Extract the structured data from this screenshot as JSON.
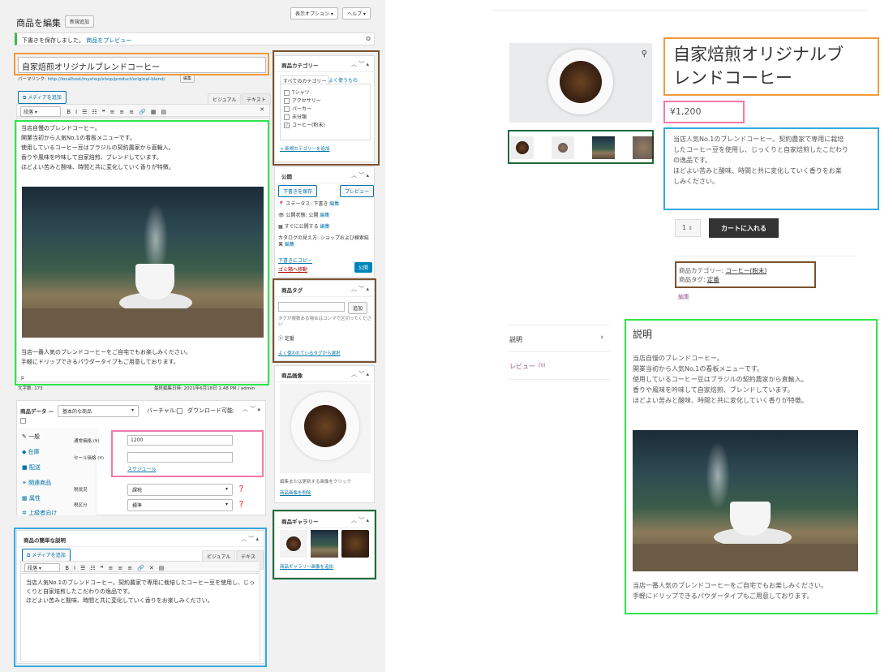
{
  "admin": {
    "page_title": "商品を編集",
    "add_new": "新規追加",
    "screen_options": "表示オプション ▾",
    "help": "ヘルプ ▾",
    "notice": "下書きを保存しました。",
    "notice_link": "商品をプレビュー",
    "product_title": "自家焙煎オリジナルブレンドコーヒー",
    "permalink_label": "パーマリンク:",
    "permalink_url": "http://localhost/myshop/shop/product/original-blend/",
    "permalink_edit": "編集",
    "add_media": "メディアを追加",
    "tab_visual": "ビジュアル",
    "tab_text": "テキスト",
    "format_select": "段落",
    "toolbar_icons": [
      "B",
      "I",
      "☰",
      "☷",
      "❝",
      "≡",
      "≡",
      "≡",
      "🔗",
      "▦",
      "▤"
    ],
    "content_lines": [
      "当店自慢のブレンドコーヒー。",
      "開業当初から人気No.1の看板メニューです。",
      "",
      "使用しているコーヒー豆はブラジルの契約農家から直輸入。",
      "香りや風味を吟味して自家焙煎、ブレンドしています。",
      "ほどよい苦みと酸味、時間と共に変化していく香りが特徴。"
    ],
    "content_lines2": [
      "当店一番人気のブレンドコーヒーをご自宅でもお楽しみください。",
      "手軽にドリップできるパウダータイプもご用意しております。"
    ],
    "content_p": "p",
    "word_count": "文字数: 173",
    "last_edited": "最終編集日時: 2021年6月18日 1:48 PM / admin",
    "product_data_label": "商品データ —",
    "product_type": "基本的な商品",
    "virtual_label": "バーチャル:",
    "download_label": "ダウンロード可能:",
    "data_tabs": [
      "一般",
      "在庫",
      "配送",
      "関連商品",
      "属性",
      "上級者向け"
    ],
    "regular_price_label": "通常価格 (¥)",
    "regular_price": "1200",
    "sale_price_label": "セール価格 (¥)",
    "sale_price": "",
    "schedule": "スケジュール",
    "tax_status_label": "税状況",
    "tax_status": "課税",
    "tax_class_label": "税区分",
    "tax_class": "標準",
    "short_desc_title": "商品の簡単な説明",
    "short_desc_lines": [
      "当店人気No.1のブレンドコーヒー。契約農家で専用に栽培したコーヒー豆を使用し、じっ",
      "くりと自家焙煎したこだわりの逸品です。",
      "",
      "ほどよい苦みと酸味、時間と共に変化していく香りをお楽しみください。"
    ],
    "categories_title": "商品カテゴリー",
    "cat_tab_all": "すべてのカテゴリー",
    "cat_tab_popular": "よく使うもの",
    "categories": [
      {
        "label": "Tシャツ",
        "checked": false
      },
      {
        "label": "アクセサリー",
        "checked": false
      },
      {
        "label": "パーカー",
        "checked": false
      },
      {
        "label": "未分類",
        "checked": false
      },
      {
        "label": "コーヒー(粉末)",
        "checked": true
      }
    ],
    "add_category": "+ 新規カテゴリーを追加",
    "publish_title": "公開",
    "save_draft": "下書きを保存",
    "preview": "プレビュー",
    "status_line": "ステータス: 下書き",
    "status_edit": "編集",
    "visibility_line": "公開状態: 公開",
    "visibility_edit": "編集",
    "schedule_line": "すぐに公開する",
    "schedule_edit": "編集",
    "catalog_line": "カタログの見え方: ショップおよび検索結果",
    "catalog_edit": "編集",
    "copy_draft": "下書きにコピー",
    "trash": "ゴミ箱へ移動",
    "publish_btn": "公開",
    "tags_title": "商品タグ",
    "tag_add_btn": "追加",
    "tag_hint": "タグが複数ある場合はコンマで区切ってください",
    "tag_item": "ⓧ 定番",
    "tag_choose": "よく使われているタグから選択",
    "image_title": "商品画像",
    "image_hint": "編集または更新する画像をクリック",
    "image_remove": "商品画像を削除",
    "gallery_title": "商品ギャラリー",
    "gallery_add": "商品ギャラリー画像を追加"
  },
  "front": {
    "product_title_line1": "自家焙煎オリジナルブ",
    "product_title_line2": "レンドコーヒー",
    "price": "¥1,200",
    "short_lines": [
      "当店人気No.1のブレンドコーヒー。契約農家で専用に栽培",
      "したコーヒー豆を使用し、じっくりと自家焙煎したこだわり",
      "の逸品です。",
      "",
      "ほどよい苦みと酸味、時間と共に変化していく香りをお楽",
      "しみください。"
    ],
    "qty": "1",
    "add_to_cart": "カートに入れる",
    "category_label": "商品カテゴリー:",
    "category_value": "コーヒー(粉末)",
    "tag_label": "商品タグ:",
    "tag_value": "定番",
    "edit_link": "編集",
    "tab_description": "説明",
    "tab_reviews": "レビュー",
    "reviews_count": "(0)",
    "desc_heading": "説明",
    "desc_lines": [
      "当店自慢のブレンドコーヒー。",
      "開業当初から人気No.1の看板メニューです。",
      "",
      "使用しているコーヒー豆はブラジルの契約農家から直輸入。",
      "香りや風味を吟味して自家焙煎、ブレンドしています。",
      "ほどよい苦みと酸味、時間と共に変化していく香りが特徴。"
    ],
    "desc_lines2": [
      "当店一番人気のブレンドコーヒーをご自宅でもお楽しみください。",
      "手軽にドリップできるパウダータイプもご用意しております。"
    ]
  },
  "colors": {
    "orange": "#f39a3a",
    "green": "#2ee64a",
    "pink": "#f07aa8",
    "blue": "#36a9dc",
    "brown": "#7a5230",
    "darkgreen": "#1f6b3a",
    "wp_blue": "#0073aa",
    "cart_btn": "#333333"
  },
  "icons": [
    "zoom-icon",
    "gear-icon",
    "media-icon",
    "fullscreen-icon",
    "chevron-up-icon",
    "chevron-down-icon",
    "caret-icon",
    "pin-icon",
    "eye-icon",
    "calendar-icon",
    "wrench-icon",
    "truck-icon",
    "link-icon",
    "grid-icon",
    "gear-advanced-icon"
  ]
}
